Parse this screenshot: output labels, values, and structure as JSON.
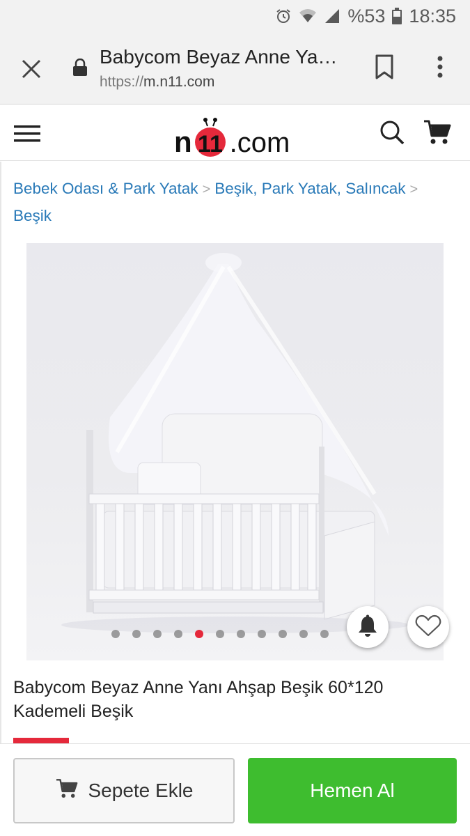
{
  "status_bar": {
    "battery_text": "%53",
    "time": "18:35",
    "icons": [
      "alarm-icon",
      "wifi-icon",
      "signal-icon",
      "battery-icon"
    ]
  },
  "browser": {
    "tab_title": "Babycom Beyaz Anne Ya…",
    "url_scheme": "https://",
    "url_host": "m.n11.com",
    "icons": [
      "close-icon",
      "lock-icon",
      "bookmark-icon",
      "more-vert-icon"
    ]
  },
  "site_header": {
    "logo_n": "n",
    "logo_domain": ".com",
    "logo_digits": "11",
    "icons": [
      "hamburger-menu-icon",
      "search-icon",
      "cart-icon"
    ]
  },
  "breadcrumb": {
    "items": [
      "Bebek Odası & Park Yatak",
      "Beşik, Park Yatak, Salıncak",
      "Beşik"
    ],
    "separator": ">"
  },
  "gallery": {
    "image_count": 12,
    "active_index": 4,
    "icons": [
      "bell-icon",
      "heart-icon"
    ]
  },
  "product": {
    "title": "Babycom Beyaz Anne Yanı Ahşap Beşik 60*120 Kademeli Beşik"
  },
  "actions": {
    "add_to_cart_label": "Sepete Ekle",
    "buy_now_label": "Hemen Al"
  },
  "colors": {
    "brand_red": "#e5293b",
    "buy_green": "#3ebd2f",
    "link_blue": "#2a7ab8"
  }
}
